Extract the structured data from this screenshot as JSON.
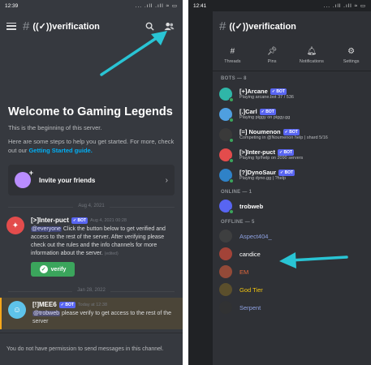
{
  "left": {
    "status": {
      "time": "12:39",
      "signal": "... .ıll .ıll ≈ ▭"
    },
    "channel": {
      "hash": "#",
      "name": "((✓))verification"
    },
    "welcome": {
      "title": "Welcome to Gaming Legends",
      "line1": "This is the beginning of this server.",
      "line2": "Here are some steps to help you get started. For more, check out our",
      "link": "Getting Started guide."
    },
    "invite_label": "Invite your friends",
    "messages": [
      {
        "date": "Aug 4, 2021",
        "author": "[>]Inter-puct",
        "badge": "✓ BOT",
        "time": "Aug 4, 2021 00:28",
        "mention": "@everyone",
        "text": " Click the button below to get verified and access to the rest of the server. After verifying please check out the rules and the info channels for more information about the server. ",
        "edited": "(edited)",
        "button": "verify"
      },
      {
        "date": "Jan 28, 2022",
        "author": "[!]MEE6",
        "badge": "✓ BOT",
        "time": "Today at 12:38",
        "mention": "@trobweb",
        "text": " please verify to get access to the rest of the server"
      }
    ],
    "no_permission": "You do not have permission to send messages in this channel."
  },
  "right": {
    "status": {
      "time": "12:41",
      "signal": "... .ıll .ıll ≈ ▭"
    },
    "channel": {
      "hash": "#",
      "name": "((✓))verification"
    },
    "tabs": [
      {
        "label": "Threads",
        "icon": "threads-icon"
      },
      {
        "label": "Pins",
        "icon": "pin-icon"
      },
      {
        "label": "Notifications",
        "icon": "bell-icon"
      },
      {
        "label": "Settings",
        "icon": "gear-icon"
      }
    ],
    "bots_header": "BOTS — 8",
    "bots": [
      {
        "name": "[+]Arcane",
        "badge": "✓ BOT",
        "activity": "Playing arcane.bot 37 / 536",
        "color": "#2fb6a8"
      },
      {
        "name": "[.]Carl",
        "badge": "✓ BOT",
        "activity": "Playing piggy on piggy.gg",
        "color": "#4f9fe0"
      },
      {
        "name": "[=] Noumenon",
        "badge": "✓ BOT",
        "activity": "Competing in @Noumenon help | shard 5/16",
        "color": "#3a3a3a"
      },
      {
        "name": "[>]Inter-puct",
        "badge": "✓ BOT",
        "activity": "Playing !ip!help on 2090 servers",
        "color": "#e34c4c"
      },
      {
        "name": "[?]DynoSaur",
        "badge": "✓ BOT",
        "activity": "Playing dyno.gg | ?help",
        "color": "#2f82c8"
      }
    ],
    "online_header": "ONLINE — 1",
    "online": [
      {
        "name": "trobweb",
        "color": "#5865f2"
      }
    ],
    "offline_header": "OFFLINE — 5",
    "offline": [
      {
        "name": "Aspect404_",
        "color": "#444444",
        "text_color": "#8ea1e1"
      },
      {
        "name": "candice",
        "color": "#c94a3a",
        "text_color": "#ffffff"
      },
      {
        "name": "EM",
        "color": "#b5533a",
        "text_color": "#e5683c"
      },
      {
        "name": "God Tier",
        "color": "#6b5a2a",
        "text_color": "#f1c40f"
      },
      {
        "name": "Serpent",
        "color": "#333333",
        "text_color": "#8ea1e1"
      }
    ]
  },
  "colors": {
    "accent": "#5865f2",
    "arrow": "#29c4d4",
    "online": "#3ba55c"
  }
}
